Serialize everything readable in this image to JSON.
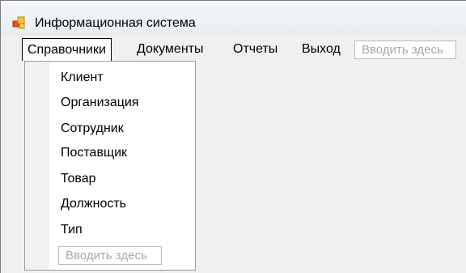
{
  "window": {
    "title": "Информационная система"
  },
  "menubar": {
    "items": [
      {
        "label": "Справочники"
      },
      {
        "label": "Документы"
      },
      {
        "label": "Отчеты"
      },
      {
        "label": "Выход"
      }
    ],
    "type_here": "Вводить здесь"
  },
  "dropdown": {
    "items": [
      {
        "label": "Клиент"
      },
      {
        "label": "Организация"
      },
      {
        "label": "Сотрудник"
      },
      {
        "label": "Поставщик"
      },
      {
        "label": "Товар"
      },
      {
        "label": "Должность"
      },
      {
        "label": "Тип"
      }
    ],
    "type_here": "Вводить здесь"
  }
}
